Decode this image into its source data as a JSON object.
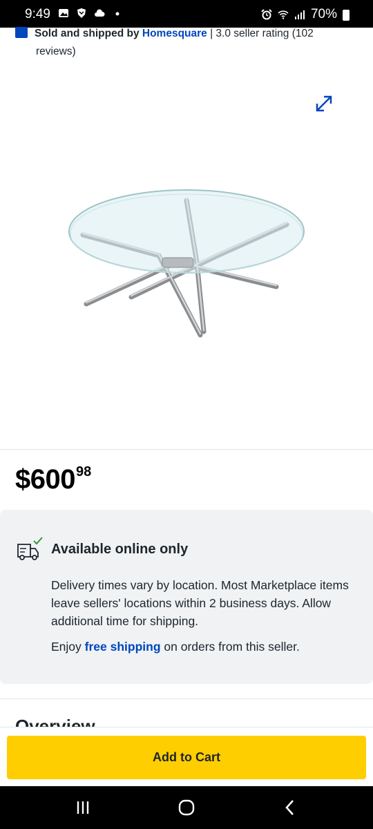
{
  "status_bar": {
    "time": "9:49",
    "battery": "70%"
  },
  "seller": {
    "prefix": "Sold and shipped by",
    "name": "Homesquare",
    "rating_line1": " | 3.0 seller rating (102",
    "rating_line2": "reviews)"
  },
  "product": {
    "image_alt": "Oval glass coffee table with crossed metal legs"
  },
  "price": {
    "dollars": "$600",
    "cents": "98"
  },
  "availability": {
    "title": "Available online only",
    "description": "Delivery times vary by location. Most Marketplace items leave sellers' locations within 2 business days. Allow additional time for shipping.",
    "shipping_prefix": "Enjoy ",
    "shipping_link": "free shipping",
    "shipping_suffix": " on orders from this seller."
  },
  "section": {
    "overview_title": "Overview"
  },
  "cart": {
    "button_label": "Add to Cart"
  },
  "colors": {
    "brand_blue": "#0046be",
    "cart_yellow": "#ffce00",
    "panel_gray": "#f0f2f4",
    "check_green": "#2e9a3a"
  },
  "icons": {
    "expand": "expand-icon",
    "truck": "delivery-truck-icon",
    "nav_recent": "recent-apps-icon",
    "nav_home": "home-icon",
    "nav_back": "back-icon"
  }
}
